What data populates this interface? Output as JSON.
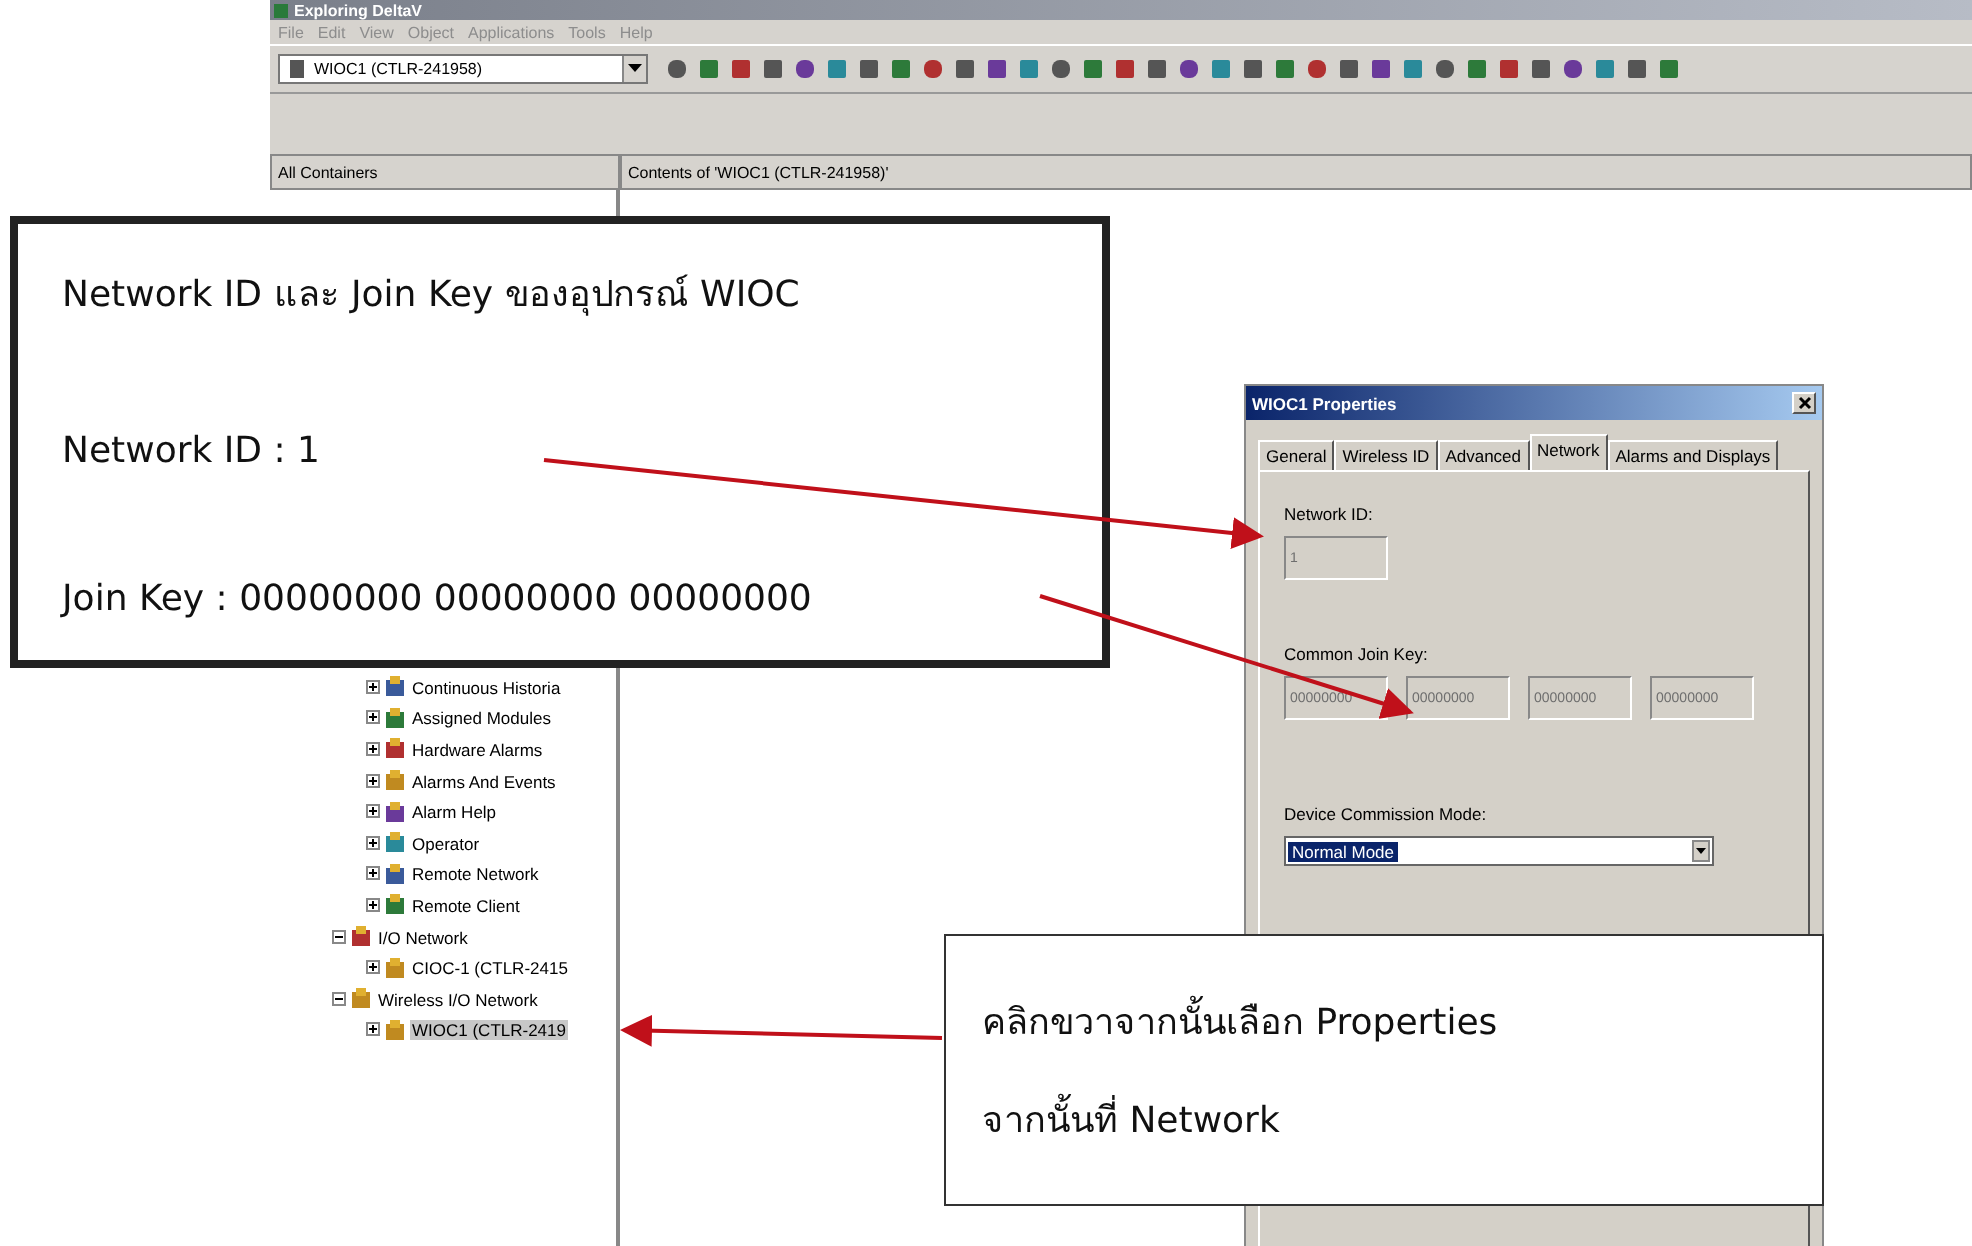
{
  "window": {
    "title": "Exploring DeltaV"
  },
  "menu": [
    "File",
    "Edit",
    "View",
    "Object",
    "Applications",
    "Tools",
    "Help"
  ],
  "location_combo": {
    "value": "WIOC1 (CTLR-241958)"
  },
  "panes": {
    "left_header": "All Containers",
    "right_header": "Contents of 'WIOC1 (CTLR-241958)'"
  },
  "tree": {
    "upper_children": [
      {
        "label": "Continuous Historia",
        "expanded": false,
        "selected": false
      },
      {
        "label": "Assigned Modules",
        "expanded": false,
        "selected": false
      },
      {
        "label": "Hardware Alarms",
        "expanded": false,
        "selected": false
      },
      {
        "label": "Alarms And Events",
        "expanded": false,
        "selected": false
      },
      {
        "label": "Alarm Help",
        "expanded": false,
        "selected": false
      },
      {
        "label": "Operator",
        "expanded": false,
        "selected": false
      },
      {
        "label": "Remote Network",
        "expanded": false,
        "selected": false
      },
      {
        "label": "Remote Client",
        "expanded": false,
        "selected": false
      }
    ],
    "nodes": [
      {
        "label": "I/O Network",
        "expanded": true,
        "selected": false,
        "children": [
          {
            "label": "CIOC-1 (CTLR-2415",
            "expanded": false,
            "selected": false
          }
        ]
      },
      {
        "label": "Wireless I/O Network",
        "expanded": true,
        "selected": false,
        "children": [
          {
            "label": "WIOC1 (CTLR-2419",
            "expanded": false,
            "selected": true
          }
        ]
      }
    ]
  },
  "dialog": {
    "title": "WIOC1 Properties",
    "tabs": [
      {
        "label": "General",
        "selected": false
      },
      {
        "label": "Wireless ID",
        "selected": false
      },
      {
        "label": "Advanced",
        "selected": false
      },
      {
        "label": "Network",
        "selected": true
      },
      {
        "label": "Alarms and Displays",
        "selected": false
      }
    ],
    "network_id": {
      "label": "Network ID:",
      "value": "1",
      "disabled": true
    },
    "join_key": {
      "label": "Common Join Key:",
      "values": [
        "00000000",
        "00000000",
        "00000000",
        "00000000"
      ],
      "disabled": true
    },
    "commission_mode": {
      "label": "Device Commission Mode:",
      "value": "Normal Mode"
    }
  },
  "callouts": [
    {
      "lines": [
        "Network ID และ Join Key ของอุปกรณ์ WIOC",
        "Network ID : 1",
        "Join Key : 00000000 00000000 00000000"
      ]
    },
    {
      "lines": [
        "คลิกขวาจากนั้นเลือก Properties",
        "จากนั้นที่ Network"
      ]
    }
  ]
}
